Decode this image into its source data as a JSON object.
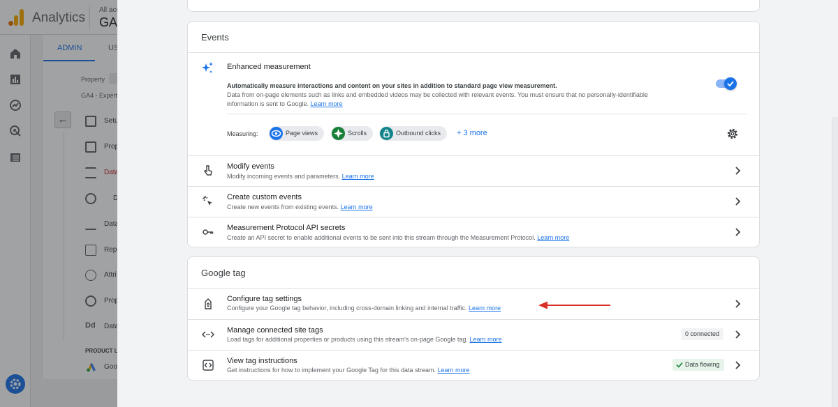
{
  "background_app": {
    "app_name": "Analytics",
    "account_small": "All acc",
    "account_big": "GA",
    "tabs": [
      "ADMIN",
      "US"
    ],
    "property_label": "Property",
    "property_name": "GA4 - Experts",
    "nav_items": [
      "Setu",
      "Prop",
      "Data",
      "D",
      "Data",
      "Repo",
      "Attri",
      "Prop",
      "Data"
    ],
    "section_label": "PRODUCT L",
    "section_item": "Goo"
  },
  "events_card": {
    "title": "Events",
    "enhanced": {
      "title": "Enhanced measurement",
      "desc_bold": "Automatically measure interactions and content on your sites in addition to standard page view measurement.",
      "desc": "Data from on-page elements such as links and embedded videos may be collected with relevant events. You must ensure that no personally-identifiable information is sent to Google.",
      "learn_more": "Learn more",
      "toggle_on": true,
      "measuring_label": "Measuring:",
      "chips": [
        {
          "label": "Page views",
          "icon": "eye-icon",
          "color": "#1a73e8"
        },
        {
          "label": "Scrolls",
          "icon": "compass-icon",
          "color": "#188038"
        },
        {
          "label": "Outbound clicks",
          "icon": "lock-icon",
          "color": "#12858a"
        }
      ],
      "more": "+ 3 more"
    },
    "rows": [
      {
        "title": "Modify events",
        "sub": "Modify incoming events and parameters.",
        "link": "Learn more",
        "icon": "touch-icon"
      },
      {
        "title": "Create custom events",
        "sub": "Create new events from existing events.",
        "link": "Learn more",
        "icon": "sparkle-click-icon"
      },
      {
        "title": "Measurement Protocol API secrets",
        "sub": "Create an API secret to enable additional events to be sent into this stream through the Measurement Protocol.",
        "link": "Learn more",
        "icon": "key-icon"
      }
    ]
  },
  "gtag_card": {
    "title": "Google tag",
    "rows": [
      {
        "title": "Configure tag settings",
        "sub": "Configure your Google tag behavior, including cross-domain linking and internal traffic.",
        "link": "Learn more",
        "icon": "tag-icon",
        "badge": ""
      },
      {
        "title": "Manage connected site tags",
        "sub": "Load tags for additional properties or products using this stream's on-page Google tag.",
        "link": "Learn more",
        "icon": "code-icon",
        "badge": "0 connected"
      },
      {
        "title": "View tag instructions",
        "sub": "Get instructions for how to implement your Google Tag for this data stream.",
        "link": "Learn more",
        "icon": "code-box-icon",
        "badge": "Data flowing"
      }
    ]
  },
  "annotation_color": "#d93025"
}
